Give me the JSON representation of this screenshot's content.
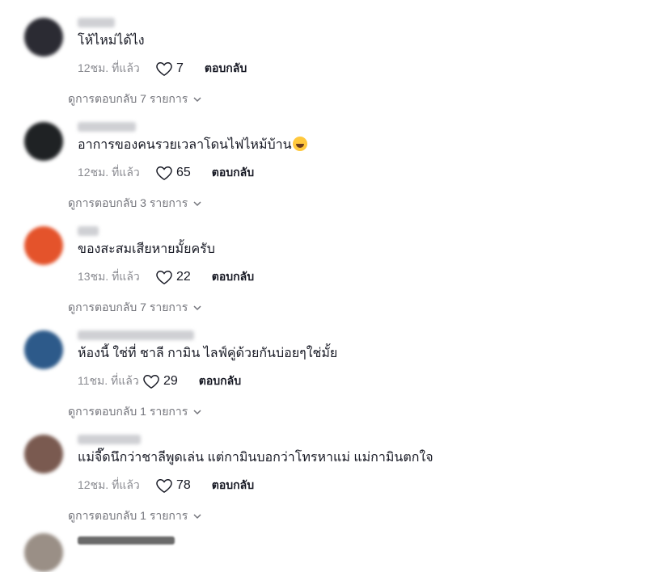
{
  "comments": [
    {
      "text": "โห้ไหม่ได้ไง",
      "time": "12ชม. ที่แล้ว",
      "likes": "7",
      "reply_label": "ตอบกลับ",
      "view_replies": "ดูการตอบกลับ 7 รายการ",
      "avatar_color": "#2b2b33"
    },
    {
      "text": "อาการของคนรวยเวลาโดนไฟไหม้บ้าน",
      "time": "12ชม. ที่แล้ว",
      "likes": "65",
      "reply_label": "ตอบกลับ",
      "view_replies": "ดูการตอบกลับ 3 รายการ",
      "avatar_color": "#1f2224"
    },
    {
      "text": "ของสะสมเสียหายมั้ยครับ",
      "time": "13ชม. ที่แล้ว",
      "likes": "22",
      "reply_label": "ตอบกลับ",
      "view_replies": "ดูการตอบกลับ 7 รายการ",
      "avatar_color": "#e4532b"
    },
    {
      "text": "ห้องนี้ ใช่ที่ ชาลี กามิน ไลฟ์คู่ด้วยกันบ่อยๆใช่มั้ย",
      "time": "11ชม. ที่แล้ว",
      "likes": "29",
      "reply_label": "ตอบกลับ",
      "view_replies": "ดูการตอบกลับ 1 รายการ",
      "avatar_color": "#2d5a8a"
    },
    {
      "text": "แม่จี๊ดนึกว่าชาลีพูดเล่น แต่กามินบอกว่าโทรหาแม่ แม่กามินตกใจ",
      "time": "12ชม. ที่แล้ว",
      "likes": "78",
      "reply_label": "ตอบกลับ",
      "view_replies": "ดูการตอบกลับ 1 รายการ",
      "avatar_color": "#7a5a50"
    }
  ],
  "icons": {
    "like": "heart-outline-icon",
    "expand": "chevron-down-icon",
    "emoji": "laughing-tears-emoji"
  },
  "colors": {
    "text": "#161823",
    "muted": "#8a8b91",
    "link": "#73747b"
  }
}
